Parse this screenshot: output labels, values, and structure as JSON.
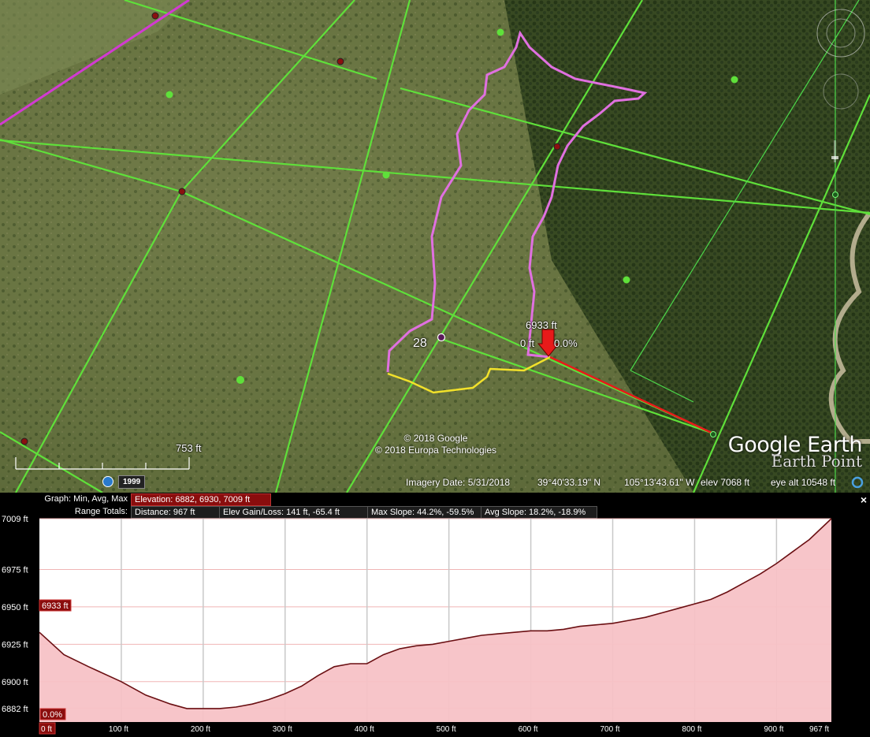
{
  "map": {
    "section_number": "28",
    "marker_elevation": "6933 ft",
    "marker_distance": "0 ft",
    "marker_slope": "0.0%",
    "scale_label": "753 ft",
    "copyright_google": "© 2018 Google",
    "copyright_europa": "© 2018 Europa Technologies",
    "logo_google_earth": "Google Earth",
    "logo_earth_point": "Earth Point",
    "history_year": "1999",
    "icons": [
      "clock-icon",
      "compass-icon",
      "look-joystick-icon",
      "zoom-slider-icon",
      "download-status-icon"
    ]
  },
  "status": {
    "imagery_date": "Imagery Date: 5/31/2018",
    "latitude": "39°40'33.19\" N",
    "longitude": "105°13'43.61\" W",
    "elevation": "elev  7068 ft",
    "eye_altitude": "eye alt  10548 ft"
  },
  "profile": {
    "graph_label": "Graph: Min, Avg, Max",
    "elevation_summary": "Elevation: 6882, 6930, 7009 ft",
    "range_label": "Range Totals:",
    "distance": "Distance: 967 ft",
    "elev_gain_loss": "Elev Gain/Loss: 141 ft, -65.4 ft",
    "max_slope": "Max Slope: 44.2%, -59.5%",
    "avg_slope": "Avg Slope: 18.2%, -18.9%",
    "close_label": "×",
    "cursor_elevation": "6933 ft",
    "cursor_slope": "0.0%",
    "cursor_distance": "0 ft"
  },
  "chart_data": {
    "type": "area",
    "xlabel": "",
    "ylabel": "",
    "x_tick_labels": [
      "0 ft",
      "100 ft",
      "200 ft",
      "300 ft",
      "400 ft",
      "500 ft",
      "600 ft",
      "700 ft",
      "800 ft",
      "900 ft",
      "967 ft"
    ],
    "x_ticks": [
      0,
      100,
      200,
      300,
      400,
      500,
      600,
      700,
      800,
      900,
      967
    ],
    "y_tick_labels": [
      "7009 ft",
      "6975 ft",
      "6950 ft",
      "6925 ft",
      "6900 ft",
      "6882 ft"
    ],
    "y_ticks": [
      7009,
      6975,
      6950,
      6925,
      6900,
      6882
    ],
    "xlim": [
      0,
      967
    ],
    "ylim": [
      6873,
      7009
    ],
    "series": [
      {
        "x": [
          0,
          30,
          60,
          100,
          130,
          160,
          180,
          200,
          220,
          240,
          260,
          280,
          300,
          320,
          340,
          360,
          380,
          400,
          420,
          440,
          460,
          480,
          500,
          520,
          540,
          560,
          580,
          600,
          620,
          640,
          660,
          680,
          700,
          720,
          740,
          760,
          780,
          800,
          820,
          840,
          860,
          880,
          900,
          920,
          940,
          967
        ],
        "y": [
          6933,
          6918,
          6910,
          6900,
          6891,
          6885,
          6882,
          6882,
          6882,
          6883,
          6885,
          6888,
          6892,
          6897,
          6904,
          6910,
          6912,
          6912,
          6918,
          6922,
          6924,
          6925,
          6927,
          6929,
          6931,
          6932,
          6933,
          6934,
          6934,
          6935,
          6937,
          6938,
          6939,
          6941,
          6943,
          6946,
          6949,
          6952,
          6955,
          6960,
          6966,
          6972,
          6979,
          6987,
          6995,
          7009
        ]
      }
    ]
  }
}
